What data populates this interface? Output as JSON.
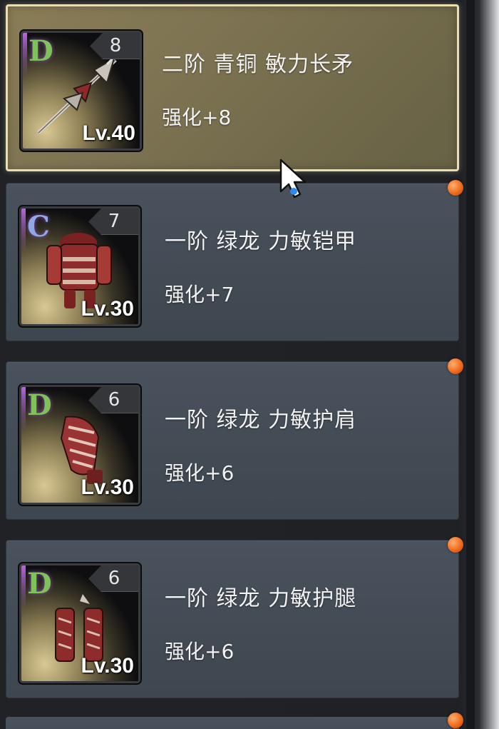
{
  "items": [
    {
      "grade": "D",
      "enhance_tab": "8",
      "level": "Lv.40",
      "name": "二阶 青铜 敏力长矛",
      "enhance": "强化+8",
      "selected": true,
      "art": "spear-icon"
    },
    {
      "grade": "C",
      "enhance_tab": "7",
      "level": "Lv.30",
      "name": "一阶 绿龙 力敏铠甲",
      "enhance": "强化+7",
      "selected": false,
      "art": "armor-icon"
    },
    {
      "grade": "D",
      "enhance_tab": "6",
      "level": "Lv.30",
      "name": "一阶 绿龙 力敏护肩",
      "enhance": "强化+6",
      "selected": false,
      "art": "pauldron-icon"
    },
    {
      "grade": "D",
      "enhance_tab": "6",
      "level": "Lv.30",
      "name": "一阶 绿龙 力敏护腿",
      "enhance": "强化+6",
      "selected": false,
      "art": "greaves-icon"
    }
  ],
  "colors": {
    "card_bg": "#464e58",
    "selected_bg": "#7d7352",
    "selected_border": "#e8deb1",
    "grade_d": "#7fc25a",
    "grade_c": "#8fa8e6",
    "notify_dot": "#f06a1c"
  }
}
